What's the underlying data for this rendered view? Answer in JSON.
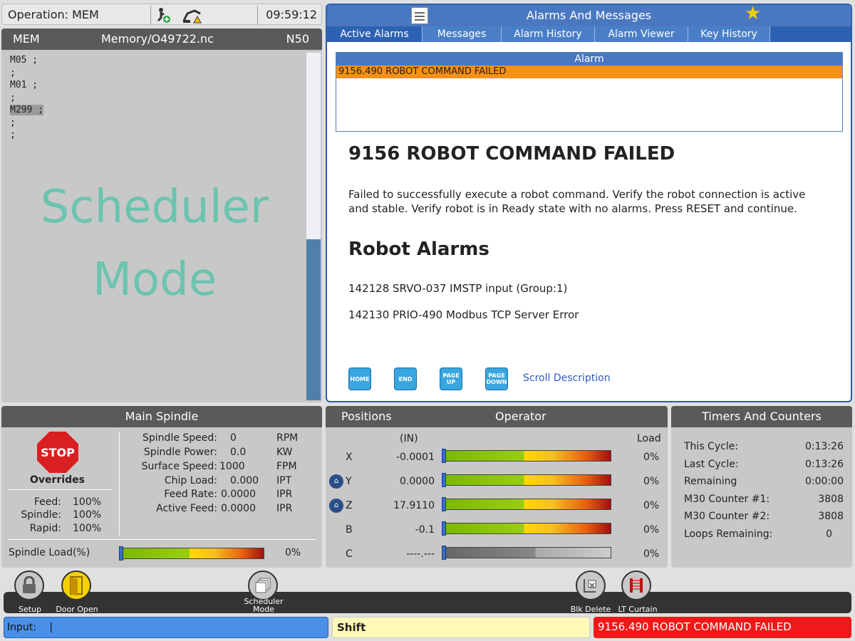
{
  "statusbar": {
    "operation": "Operation: MEM",
    "icons": [
      "jog-probe-icon",
      "robot-warning-icon"
    ],
    "time": "09:59:12"
  },
  "program": {
    "mode": "MEM",
    "file": "Memory/O49722.nc",
    "line": "N50",
    "code": [
      "M05 ;",
      ";",
      "M01 ;",
      ";",
      "M299 ;",
      ";",
      ";"
    ],
    "watermark_1": "Scheduler",
    "watermark_2": "Mode"
  },
  "alarms": {
    "title": "Alarms And Messages",
    "tabs": [
      "Active Alarms",
      "Messages",
      "Alarm History",
      "Alarm Viewer",
      "Key History"
    ],
    "table_header": "Alarm",
    "active_alarm": "9156.490 ROBOT COMMAND FAILED",
    "heading": "9156 ROBOT COMMAND FAILED",
    "description": "Failed to successfully execute a robot command. Verify the robot connection is active and stable. Verify robot is in Ready state with no alarms.  Press RESET and continue.",
    "robot_heading": "Robot Alarms",
    "robot_alarms": [
      "142128 SRVO-037 IMSTP input (Group:1)",
      "142130 PRIO-490 Modbus TCP Server Error"
    ],
    "nav": {
      "home": "HOME",
      "end": "END",
      "page_up": "PAGE UP",
      "page_down": "PAGE DOWN"
    },
    "scroll_label": "Scroll Description"
  },
  "spindle": {
    "title": "Main Spindle",
    "stop_label": "STOP",
    "overrides_label": "Overrides",
    "overrides": [
      {
        "label": "Feed:",
        "value": "100%"
      },
      {
        "label": "Spindle:",
        "value": "100%"
      },
      {
        "label": "Rapid:",
        "value": "100%"
      }
    ],
    "stats": [
      {
        "label": "Spindle Speed:",
        "value": "0",
        "unit": "RPM"
      },
      {
        "label": "Spindle Power:",
        "value": "0.0",
        "unit": "KW"
      },
      {
        "label": "Surface Speed:",
        "value": "1000",
        "unit": "FPM"
      },
      {
        "label": "Chip Load:",
        "value": "0.000",
        "unit": "IPT"
      },
      {
        "label": "Feed Rate:",
        "value": "0.0000",
        "unit": "IPR"
      },
      {
        "label": "Active Feed:",
        "value": "0.0000",
        "unit": "IPR"
      }
    ],
    "load_label": "Spindle Load(%)",
    "load_value": "0%",
    "load_fraction": 0
  },
  "positions": {
    "title_left": "Positions",
    "title_right": "Operator",
    "unit_label": "(IN)",
    "load_label": "Load",
    "axes": [
      {
        "axis": "X",
        "value": "-0.0001",
        "load": "0%",
        "home": false,
        "enabled": true
      },
      {
        "axis": "Y",
        "value": "0.0000",
        "load": "0%",
        "home": true,
        "enabled": true
      },
      {
        "axis": "Z",
        "value": "17.9110",
        "load": "0%",
        "home": true,
        "enabled": true
      },
      {
        "axis": "B",
        "value": "-0.1",
        "load": "0%",
        "home": false,
        "enabled": true
      },
      {
        "axis": "C",
        "value": "----.---",
        "load": "0%",
        "home": false,
        "enabled": false
      }
    ]
  },
  "timers": {
    "title": "Timers And Counters",
    "rows": [
      {
        "label": "This Cycle:",
        "value": "0:13:26"
      },
      {
        "label": "Last Cycle:",
        "value": "0:13:26"
      },
      {
        "label": "Remaining",
        "value": "0:00:00"
      },
      {
        "label": "M30 Counter #1:",
        "value": "3808"
      },
      {
        "label": "M30 Counter #2:",
        "value": "3808"
      },
      {
        "label": "Loops Remaining:",
        "value": "0"
      }
    ]
  },
  "toolbar": {
    "setup": "Setup",
    "door_open": "Door Open",
    "scheduler_mode_1": "Scheduler",
    "scheduler_mode_2": "Mode",
    "blk_delete": "Blk Delete",
    "lt_curtain": "LT Curtain"
  },
  "input": {
    "label": "Input:",
    "cursor": "|",
    "shift": "Shift",
    "error": "9156.490 ROBOT COMMAND FAILED"
  },
  "colors": {
    "header_gray": "#5a5a5a",
    "alarm_orange": "#f59018",
    "error_red": "#f01818",
    "accent_blue": "#4a78c0",
    "watermark_teal": "#6cc4ae"
  }
}
